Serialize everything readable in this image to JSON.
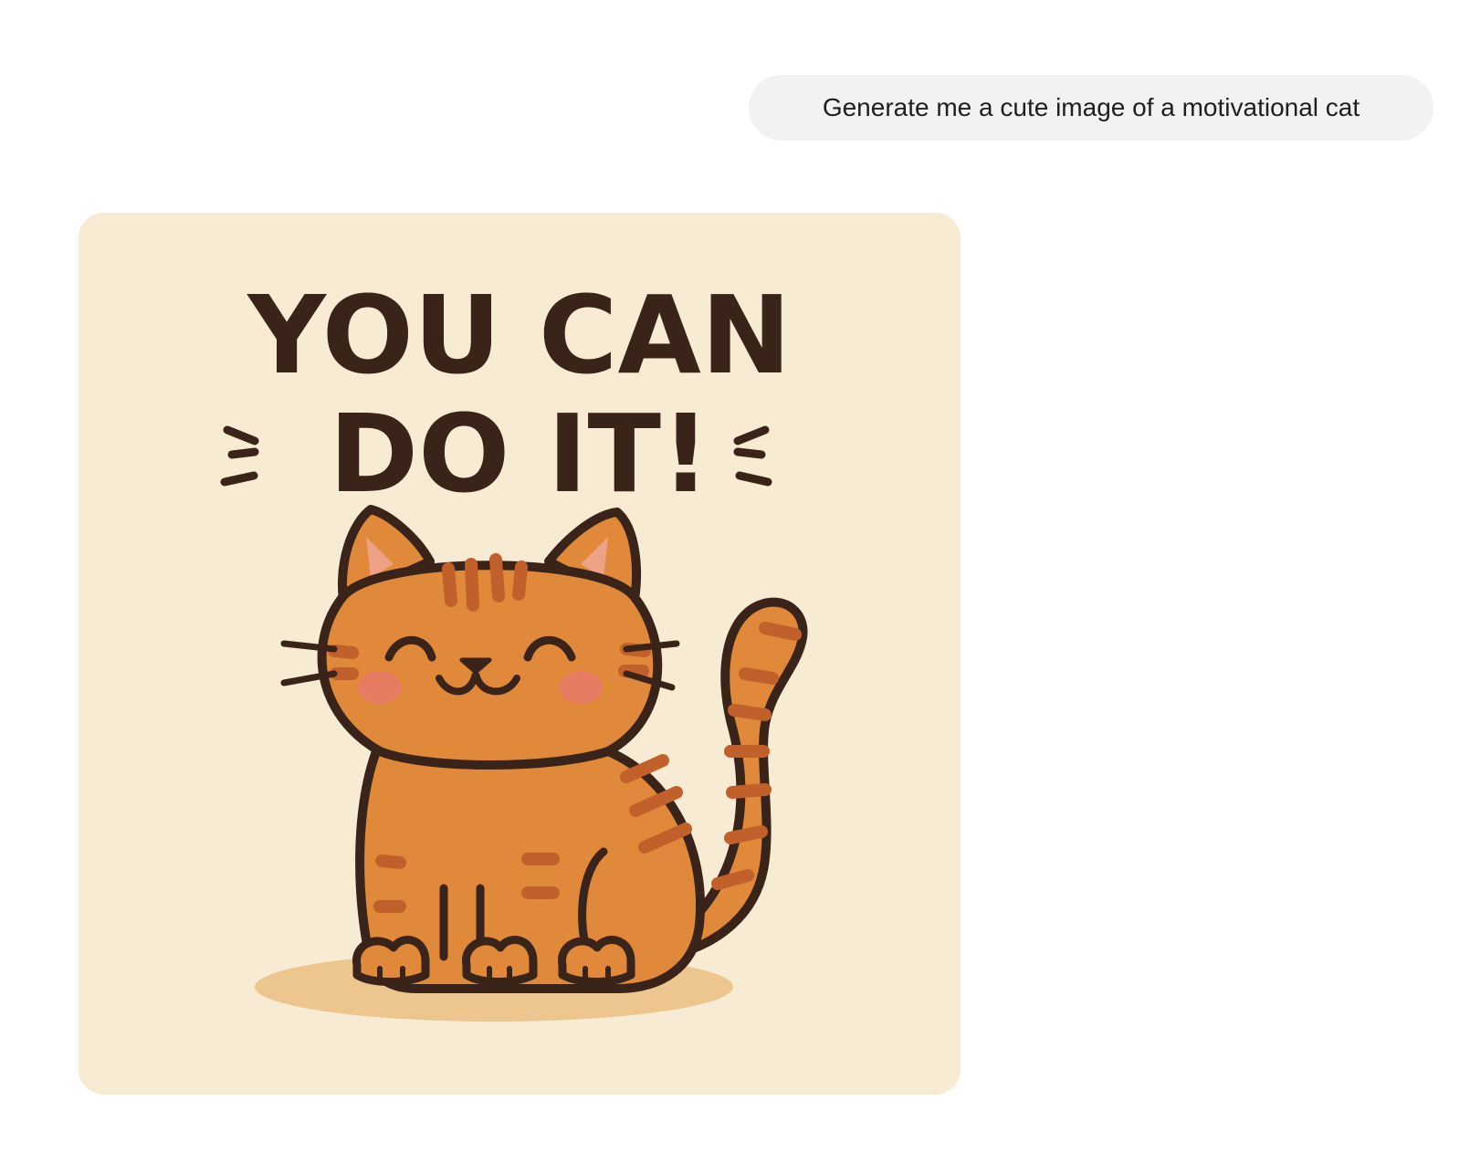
{
  "chat": {
    "user_message": "Generate me a cute image of a motivational cat"
  },
  "generated_image": {
    "subject": "cartoon-orange-tabby-cat",
    "text_line_1": "YOU CAN",
    "text_line_2": "DO IT!"
  },
  "colors": {
    "bubble_background": "#f2f2f2",
    "image_background": "#f7ebd3",
    "cat_fur": "#e0893a",
    "cat_stripes": "#c1602a",
    "outline": "#3a2318",
    "blush": "#e8796a"
  }
}
